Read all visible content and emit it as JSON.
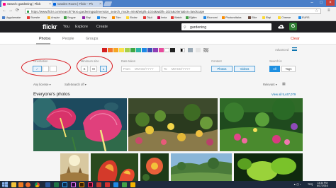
{
  "browser": {
    "tabs": [
      {
        "title": "Search: gardening | Flick",
        "active": true
      },
      {
        "title": "Garden Room | Flickr - Ph",
        "active": false
      }
    ],
    "address": "https://www.flickr.com/search/?text=gardening&dimension_search_mode=min&height=1024&width=1024&orientation=landscape",
    "bookmarks": [
      "Uygulamalar",
      "Sivesite",
      "Araçlar",
      "Seyyar",
      "Ekşi",
      "Kitap",
      "Tüm",
      "Ekolar",
      "Ölçü",
      "İnsta",
      "Watch",
      "Eğitim",
      "Ekonomi",
      "Photovoltaics",
      "Ekle",
      "Ekşi",
      "Cheese",
      "EURS"
    ]
  },
  "flickr_nav": {
    "logo": "flickr",
    "links": [
      "You",
      "Explore",
      "Create"
    ],
    "search_value": "gardening",
    "avatar_letter": "G"
  },
  "subtabs": {
    "items": [
      "Photos",
      "People",
      "Groups"
    ],
    "active": "Photos",
    "clear_label": "Clear"
  },
  "filters": {
    "swatches": [
      "#d41e1e",
      "#f4762a",
      "#f5a623",
      "#f7e14a",
      "#a8d04a",
      "#3ea845",
      "#2bb3a8",
      "#1e88e5",
      "#3f51b5",
      "#8e3fb5",
      "#e74c9c",
      "#ffffff",
      "#222222"
    ],
    "advanced_label": "Advanced",
    "orientation": {
      "label": "Orientation"
    },
    "minimum_size": {
      "label": "Minimum size",
      "options": [
        "S",
        "M",
        "L"
      ],
      "selected": "L"
    },
    "date_taken": {
      "label": "Date taken",
      "from_prefix": "From",
      "to_prefix": "To",
      "placeholder": "MM-DD/YYYY"
    },
    "content": {
      "label": "Content",
      "options": [
        "Photos",
        "Videos"
      ]
    },
    "search_in": {
      "label": "Search in",
      "options": [
        "All",
        "Tags"
      ],
      "selected": "All"
    }
  },
  "results": {
    "license": "Any license",
    "safesearch": "SafeSearch off",
    "relevant": "Relevant",
    "heading": "Everyone's photos",
    "view_all": "View all 5,447,079"
  },
  "taskbar": {
    "time": "13:34 PM",
    "date": "6/17/2016",
    "language": "TRQ"
  }
}
